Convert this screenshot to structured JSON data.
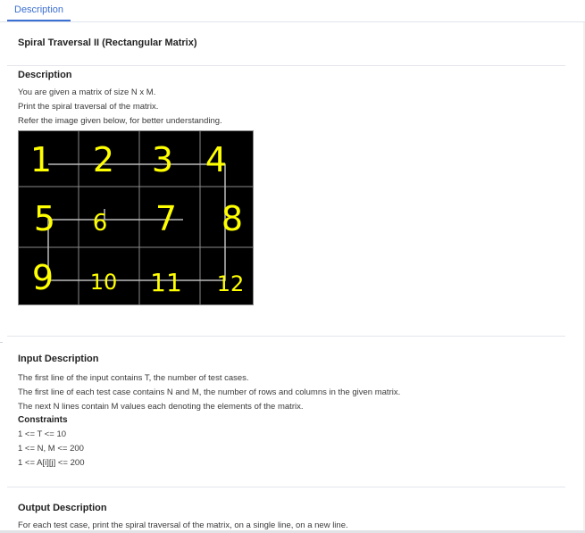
{
  "tabs": {
    "description": "Description"
  },
  "problem": {
    "title": "Spiral Traversal II (Rectangular Matrix)",
    "description_heading": "Description",
    "description_lines": [
      "You are given a matrix of size N x M.",
      "Print the spiral traversal of the matrix.",
      "Refer the image given below, for better understanding."
    ],
    "matrix_cells": [
      "1",
      "2",
      "3",
      "4",
      "5",
      "6",
      "7",
      "8",
      "9",
      "10",
      "11",
      "12"
    ],
    "input_heading": "Input Description",
    "input_lines": [
      "The first line of the input contains T, the number of test cases.",
      "The first line of each test case contains N and M, the number of rows and columns in the given matrix.",
      "The next N lines contain M values each denoting the elements of the matrix."
    ],
    "constraints_heading": "Constraints",
    "constraints": [
      "1 <= T <= 10",
      "1 <= N, M <= 200",
      "1 <= A[i][j] <= 200"
    ],
    "output_heading": "Output Description",
    "output_lines": [
      "For each test case, print the spiral traversal of the matrix, on a single line, on a new line."
    ]
  },
  "colors": {
    "accent": "#3b6fd1",
    "digit": "#ffff00",
    "grid": "#8a8a8a",
    "path": "#bcbcbc"
  }
}
